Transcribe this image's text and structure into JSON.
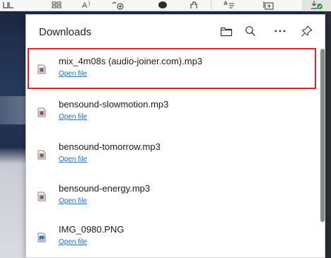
{
  "toolbar": {
    "icons": [
      "reading-view-icon",
      "apps-icon",
      "read-aloud-icon",
      "add-favorite-icon",
      "profile-icon",
      "extensions-icon",
      "favorites-icon",
      "collections-icon",
      "downloads-icon"
    ]
  },
  "downloads": {
    "title": "Downloads",
    "header_icons": [
      "open-folder-icon",
      "search-icon",
      "more-options-icon",
      "pin-icon"
    ],
    "items": [
      {
        "name": "mix_4m08s (audio-joiner.com).mp3",
        "action": "Open file",
        "type": "audio",
        "selected": true
      },
      {
        "name": "bensound-slowmotion.mp3",
        "action": "Open file",
        "type": "audio"
      },
      {
        "name": "bensound-tomorrow.mp3",
        "action": "Open file",
        "type": "audio"
      },
      {
        "name": "bensound-energy.mp3",
        "action": "Open file",
        "type": "audio"
      },
      {
        "name": "IMG_0980.PNG",
        "action": "Open file",
        "type": "image"
      }
    ]
  },
  "colors": {
    "selection_outline": "#d9262a",
    "link": "#1a6fc9",
    "download_badge": "#2a9d3f"
  }
}
